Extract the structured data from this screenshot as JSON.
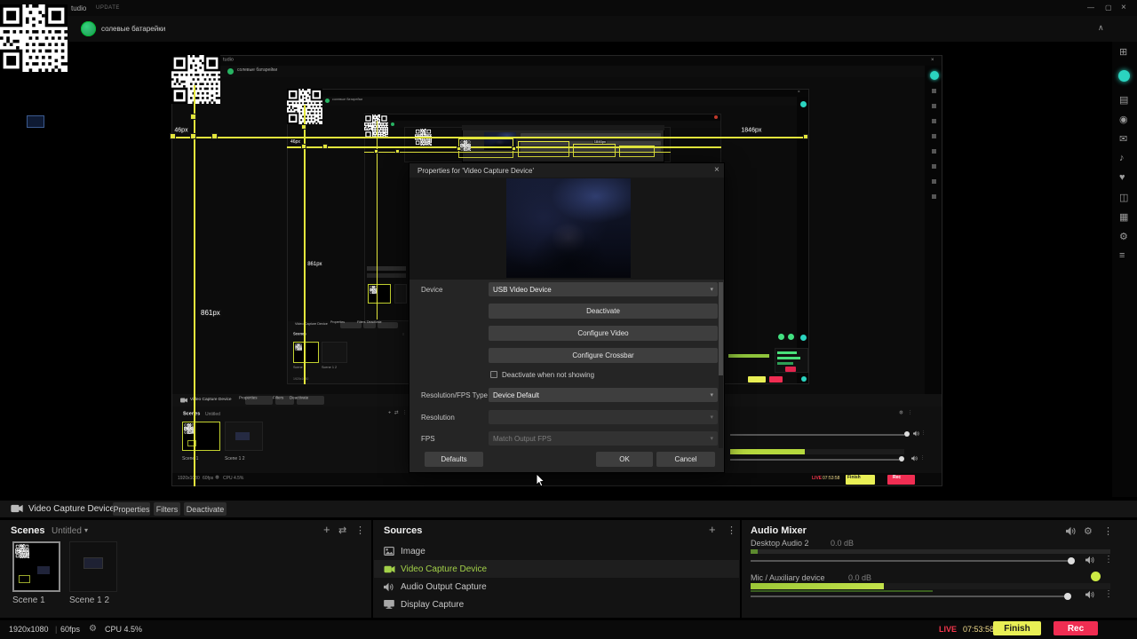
{
  "app": {
    "title": "tudio",
    "update_badge": "UPDATE",
    "account_name": "солевые батарейки"
  },
  "icons": {
    "minimize": "—",
    "maximize": "▢",
    "close": "×",
    "chevron_up": "∧",
    "chevron_down": "▾",
    "plus": "+",
    "swap": "⇄",
    "dots": "⋮",
    "gear": "⚙",
    "sidebar": [
      "⊞",
      "▤",
      "◉",
      "✉",
      "♪",
      "♥",
      "◫",
      "▦",
      "⚙",
      "≡"
    ]
  },
  "dialog": {
    "title": "Properties for 'Video Capture Device'",
    "device_label": "Device",
    "device_value": "USB Video Device",
    "deactivate_button": "Deactivate",
    "configure_video_button": "Configure Video",
    "configure_crossbar_button": "Configure Crossbar",
    "deactivate_checkbox_label": "Deactivate when not showing",
    "resolution_fps_type_label": "Resolution/FPS Type",
    "resolution_fps_type_value": "Device Default",
    "resolution_label": "Resolution",
    "resolution_value": "",
    "fps_label": "FPS",
    "fps_value": "Match Output FPS",
    "defaults_button": "Defaults",
    "ok_button": "OK",
    "cancel_button": "Cancel"
  },
  "source_toolbar": {
    "source_name": "Video Capture Device",
    "properties": "Properties",
    "filters": "Filters",
    "deactivate": "Deactivate"
  },
  "scenes": {
    "title": "Scenes",
    "collection": "Untitled",
    "items": [
      {
        "name": "Scene 1"
      },
      {
        "name": "Scene 1 2"
      }
    ]
  },
  "sources": {
    "title": "Sources",
    "items": [
      {
        "name": "Image",
        "active": false
      },
      {
        "name": "Video Capture Device",
        "active": true
      },
      {
        "name": "Audio Output Capture",
        "active": false
      },
      {
        "name": "Display Capture",
        "active": false
      }
    ]
  },
  "mixer": {
    "title": "Audio Mixer",
    "channels": [
      {
        "name": "Desktop Audio 2",
        "level": "0.0 dB"
      },
      {
        "name": "Mic / Auxiliary device",
        "level": "0.0 dB"
      }
    ]
  },
  "statusbar": {
    "resolution": "1920x1080",
    "separator": "|",
    "fps": "60fps",
    "cpu": "CPU 4.5%",
    "live": "LIVE",
    "time": "07:53:58",
    "finish_button": "Finish",
    "rec_button": "Rec"
  },
  "transform": {
    "offset_label": "46px",
    "height_label": "861px",
    "width_label": "1846px"
  },
  "colors": {
    "transform_yellow": "#e3e63c",
    "accent_green": "#a3d149",
    "finish_yellow": "#e9ef55",
    "rec_red": "#f02d52",
    "live_red": "#f4364c",
    "toggle_green": "#cdeb45",
    "meter_green": "#b6d93e",
    "avatar_green": "#28b463",
    "badge_teal": "#2bd4c0"
  }
}
